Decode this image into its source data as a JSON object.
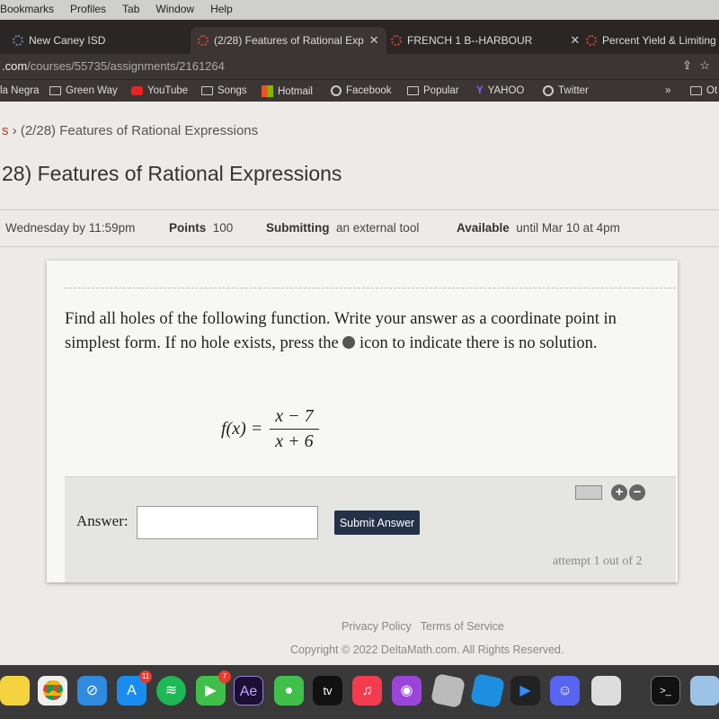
{
  "menubar": {
    "items": [
      "Bookmarks",
      "Profiles",
      "Tab",
      "Window",
      "Help"
    ]
  },
  "tabs": [
    {
      "label": "New Caney ISD"
    },
    {
      "label": "(2/28) Features of Rational Exp"
    },
    {
      "label": "FRENCH 1 B--HARBOUR"
    },
    {
      "label": "Percent Yield & Limiting"
    }
  ],
  "address": {
    "host": ".com",
    "path": "/courses/55735/assignments/2161264"
  },
  "bookmarks": [
    "la Negra",
    "Green Way",
    "YouTube",
    "Songs",
    "Hotmail",
    "Facebook",
    "Popular",
    "YAHOO",
    "Twitter",
    "»",
    "Ot"
  ],
  "breadcrumb": {
    "prev": "s",
    "sep": "›",
    "current": "(2/28) Features of Rational Expressions"
  },
  "page_title": "28) Features of Rational Expressions",
  "details": {
    "due": "Wednesday by 11:59pm",
    "points_label": "Points",
    "points": "100",
    "submitting_label": "Submitting",
    "submitting": "an external tool",
    "available_label": "Available",
    "available": "until Mar 10 at 4pm"
  },
  "question": {
    "text1": "Find all holes of the following function. Write your answer as a coordinate point in simplest form. If no hole exists, press the",
    "text2": "icon to indicate there is no solution.",
    "func_lhs": "f(x) =",
    "numerator": "x − 7",
    "denominator": "x + 6"
  },
  "answer": {
    "label": "Answer:",
    "value": "",
    "submit": "Submit Answer",
    "plus": "+",
    "minus": "−",
    "attempt": "attempt 1 out of 2"
  },
  "footer": {
    "privacy": "Privacy Policy",
    "terms": "Terms of Service",
    "copyright": "Copyright © 2022 DeltaMath.com. All Rights Reserved."
  },
  "dock": [
    {
      "name": "notes"
    },
    {
      "name": "chrome"
    },
    {
      "name": "safari"
    },
    {
      "name": "app-store",
      "badge": "11"
    },
    {
      "name": "spotify"
    },
    {
      "name": "facetime",
      "badge": "7"
    },
    {
      "name": "after-effects",
      "label": "Ae"
    },
    {
      "name": "messages"
    },
    {
      "name": "apple-tv",
      "label": "tv"
    },
    {
      "name": "music"
    },
    {
      "name": "podcasts"
    },
    {
      "name": "roblox"
    },
    {
      "name": "roblox-studio"
    },
    {
      "name": "zoom"
    },
    {
      "name": "discord"
    },
    {
      "name": "preview"
    },
    {
      "name": "terminal",
      "label": ">_"
    },
    {
      "name": "photo"
    }
  ]
}
